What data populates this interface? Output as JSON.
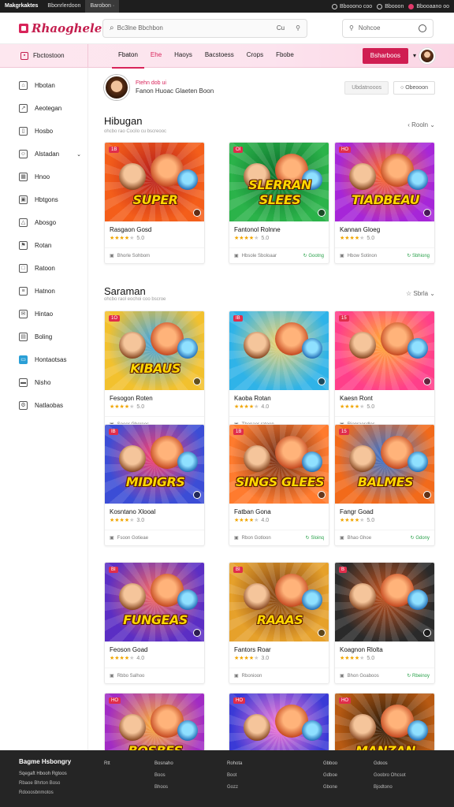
{
  "sysbar": {
    "tabs": [
      "Makgrkaktes",
      "Bbonrlerdoon",
      "Barobon"
    ],
    "right": [
      "Bbooono coo",
      "Bbooon",
      "Bbooaano oo"
    ]
  },
  "header": {
    "logo": "Rhaoghele",
    "search_placeholder": "Bc3lne Bbchbon",
    "search_clear": "Cu",
    "search2_placeholder": "Nohcoe"
  },
  "navbar": {
    "home_label": "Fbctostoon",
    "items": [
      "Fbaton",
      "Ehe",
      "Haoys",
      "Bacstoess",
      "Crops",
      "Fbobe"
    ],
    "cta": "Bsharboos"
  },
  "sidebar": {
    "items": [
      {
        "label": "Hbotan",
        "icon": "home-icon"
      },
      {
        "label": "Aeotegan",
        "icon": "trend-icon"
      },
      {
        "label": "Hosbo",
        "icon": "bookmark-icon"
      },
      {
        "label": "Alstadan",
        "icon": "smile-icon"
      },
      {
        "label": "Hnoo",
        "icon": "grid-icon"
      },
      {
        "label": "Hbtgons",
        "icon": "pin-icon"
      },
      {
        "label": "Abosgo",
        "icon": "triangle-icon"
      },
      {
        "label": "Rotan",
        "icon": "flag-icon"
      },
      {
        "label": "Ratoon",
        "icon": "box-icon"
      },
      {
        "label": "Hatnon",
        "icon": "list-icon"
      },
      {
        "label": "Hintao",
        "icon": "mail-icon"
      },
      {
        "label": "Boling",
        "icon": "doc-icon"
      },
      {
        "label": "Hontaotsas",
        "icon": "monitor-icon"
      },
      {
        "label": "Nisho",
        "icon": "card-icon"
      },
      {
        "label": "Natlaobas",
        "icon": "settings-icon"
      }
    ]
  },
  "profile": {
    "name": "Ftehn dob ui",
    "meta": "Fanon Huoac Glaeten Boon",
    "btn1": "Ubdatnooos",
    "btn2": "Obeooon"
  },
  "sections": [
    {
      "title": "Hibugan",
      "sub": "ohcbo rao Cocilo cu bscreooc",
      "right": "Rooln"
    },
    {
      "title": "Saraman",
      "sub": "ohcbo raol eochoi coo bscroe",
      "right": "Sbrla"
    }
  ],
  "cards": [
    {
      "name": "Rasgaon Gosd",
      "rating": "5.0",
      "footer": "Bhorle Sohbom",
      "right": "",
      "art": "SUPER",
      "c1": "#f45e1a",
      "c2": "#b41c1c",
      "badge": "1B"
    },
    {
      "name": "Fantonol Rolnne",
      "rating": "5.0",
      "footer": "Hbsole Sboloaar",
      "right": "Gootng",
      "art": "SLERRAN SLEES",
      "c1": "#2bb34a",
      "c2": "#0a6d2a",
      "badge": "OI"
    },
    {
      "name": "Kannan Gloeg",
      "rating": "5.0",
      "footer": "Hbow Sotinon",
      "right": "Sbhiong",
      "art": "TIADBEAU",
      "c1": "#a626d8",
      "c2": "#ff6a1a",
      "badge": "HO"
    },
    {
      "name": "Fesogon Roten",
      "rating": "5.0",
      "footer": "Soeer Gbcrees",
      "right": "",
      "art": "KIBAUS",
      "c1": "#f2c12e",
      "c2": "#38a3e8",
      "badge": "1O"
    },
    {
      "name": "Kaoba Rotan",
      "rating": "4.0",
      "footer": "Tbonaor rateen",
      "right": "",
      "art": "",
      "c1": "#2fb3e8",
      "c2": "#f6d36a",
      "badge": "IB"
    },
    {
      "name": "Kaesn Ront",
      "rating": "5.0",
      "footer": "Rionraosdlos",
      "right": "",
      "art": "",
      "c1": "#ff3f8a",
      "c2": "#ffb02e",
      "badge": "15"
    },
    {
      "name": "Kosntano Xlooal",
      "rating": "3.0",
      "footer": "Fsoon Gotieae",
      "right": "",
      "art": "MIDIGRS",
      "c1": "#3b4dd6",
      "c2": "#ff3f6a",
      "badge": "IB"
    },
    {
      "name": "Fatban Gona",
      "rating": "4.0",
      "footer": "Rbon Gotloon",
      "right": "Sloinq",
      "art": "SINGS GLEES",
      "c1": "#ff7b2e",
      "c2": "#6b2b16",
      "badge": "1B"
    },
    {
      "name": "Fangr Goad",
      "rating": "5.0",
      "footer": "Bhao Ghoe",
      "right": "Gdony",
      "art": "BALMES",
      "c1": "#f26a1a",
      "c2": "#2b72d8",
      "badge": "15"
    },
    {
      "name": "Feoson Goad",
      "rating": "4.0",
      "footer": "Rbbo Salhoo",
      "right": "",
      "art": "FUNGEAS",
      "c1": "#5b2ec4",
      "c2": "#ff6b5a",
      "badge": "BI"
    },
    {
      "name": "Fantors Roar",
      "rating": "3.0",
      "footer": "Rbonioon",
      "right": "",
      "art": "RAAAS",
      "c1": "#e6a12b",
      "c2": "#7c3c12",
      "badge": "BI"
    },
    {
      "name": "Koagnon Rlolta",
      "rating": "5.0",
      "footer": "Bhon Goaboos",
      "right": "Rbeinoy",
      "art": "",
      "c1": "#2a2a2a",
      "c2": "#c8531c",
      "badge": "B"
    },
    {
      "name": "",
      "rating": "",
      "footer": "",
      "right": "",
      "art": "BOSBES",
      "c1": "#a12bc4",
      "c2": "#ffb12e",
      "badge": "HO"
    },
    {
      "name": "",
      "rating": "",
      "footer": "",
      "right": "",
      "art": "",
      "c1": "#3a3ad6",
      "c2": "#ff7ad4",
      "badge": "HO"
    },
    {
      "name": "",
      "rating": "",
      "footer": "",
      "right": "",
      "art": "MANZAN",
      "c1": "#b85a12",
      "c2": "#2a1a0a",
      "badge": "HO"
    }
  ],
  "footer": {
    "brand": "Bagme Hsbongry",
    "cols": [
      [
        "Rtt"
      ],
      [
        "Bosnaho",
        "Boos",
        "Bhoos"
      ],
      [
        "Rohota",
        "Boot",
        "Gozz"
      ],
      [
        "Gbboo",
        "Gdboe",
        "Gbone"
      ],
      [
        "Gdoos",
        "Goobro Ohcsot",
        "Bjodtono"
      ]
    ],
    "brand_lines": [
      "Sqegaft Hbooh Rgtoos",
      "Rbaoe Bhrton Boso",
      "Rdooosbnmotos"
    ]
  }
}
